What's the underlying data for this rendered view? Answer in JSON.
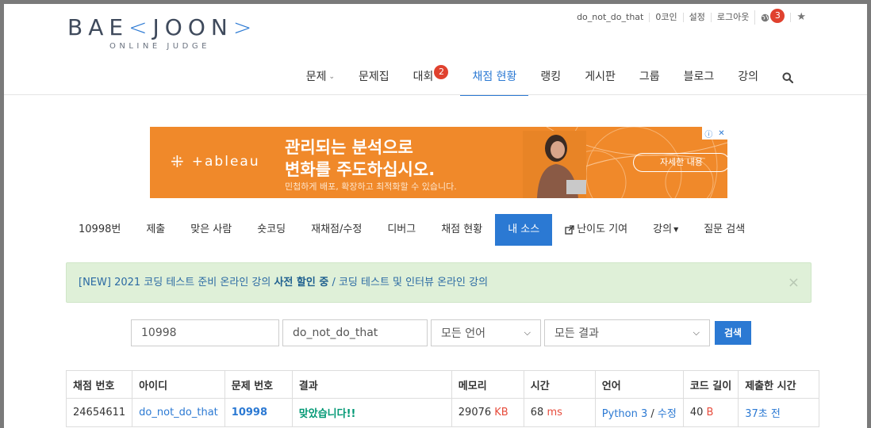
{
  "logo": {
    "main_left": "BAE",
    "bracket_left": "<",
    "main_right": "JOON",
    "bracket_right": ">",
    "sub": "ONLINE JUDGE"
  },
  "topbar": {
    "username": "do_not_do_that",
    "coins": "0코인",
    "settings": "설정",
    "logout": "로그아웃",
    "notification_count": "3",
    "globe_icon": "globe-icon",
    "star_icon": "star-icon"
  },
  "nav": {
    "items": [
      {
        "label": "문제"
      },
      {
        "label": "문제집"
      },
      {
        "label": "대회",
        "badge": "2"
      },
      {
        "label": "채점 현황"
      },
      {
        "label": "랭킹"
      },
      {
        "label": "게시판"
      },
      {
        "label": "그룹"
      },
      {
        "label": "블로그"
      },
      {
        "label": "강의"
      }
    ],
    "active": "채점 현황",
    "search_icon": "search-icon"
  },
  "ad": {
    "brand": "+ableau",
    "headline1": "관리되는 분석으로",
    "headline2": "변화를 주도하십시오.",
    "subtext": "민첩하게 배포, 확장하고 최적화할 수 있습니다.",
    "cta": "자세한 내용",
    "accent": "#f0892a"
  },
  "problem_menu": {
    "items": [
      {
        "label": "10998번"
      },
      {
        "label": "제출"
      },
      {
        "label": "맞은 사람"
      },
      {
        "label": "숏코딩"
      },
      {
        "label": "재채점/수정"
      },
      {
        "label": "디버그"
      },
      {
        "label": "채점 현황"
      },
      {
        "label": "내 소스"
      },
      {
        "label": "난이도 기여"
      },
      {
        "label": "강의"
      },
      {
        "label": "질문 검색"
      }
    ],
    "active": "내 소스"
  },
  "alert": {
    "prefix": "[NEW] 2021 코딩 테스트 준비 온라인 강의 ",
    "bold": "사전 할인 중",
    "suffix": " / 코딩 테스트 및 인터뷰 온라인 강의",
    "close": "×"
  },
  "search": {
    "problem_id": "10998",
    "user_id": "do_not_do_that",
    "language": "모든 언어",
    "result": "모든 결과",
    "button": "검색"
  },
  "table": {
    "headers": [
      "채점 번호",
      "아이디",
      "문제 번호",
      "결과",
      "메모리",
      "시간",
      "언어",
      "코드 길이",
      "제출한 시간"
    ],
    "rows": [
      {
        "submission_id": "24654611",
        "user": "do_not_do_that",
        "problem": "10998",
        "result": "맞았습니다!!",
        "memory": "29076",
        "memory_unit": "KB",
        "time": "68",
        "time_unit": "ms",
        "language": "Python 3",
        "edit": "수정",
        "code_length": "40",
        "code_unit": "B",
        "submitted": "37초 전"
      }
    ]
  }
}
